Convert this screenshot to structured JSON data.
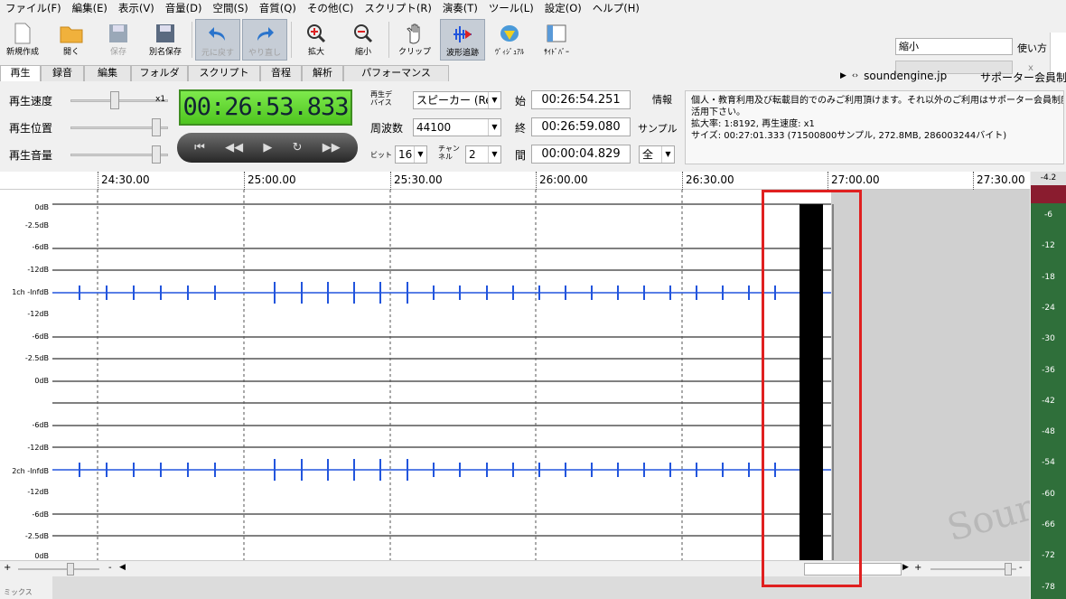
{
  "menu": [
    "ファイル(F)",
    "編集(E)",
    "表示(V)",
    "音量(D)",
    "空間(S)",
    "音質(Q)",
    "その他(C)",
    "スクリプト(R)",
    "演奏(T)",
    "ツール(L)",
    "設定(O)",
    "ヘルプ(H)"
  ],
  "toolbar": {
    "new": "新規作成",
    "open": "開く",
    "save": "保存",
    "save_as": "別名保存",
    "undo": "元に戻す",
    "redo": "やり直し",
    "zoom_in": "拡大",
    "zoom_out": "縮小",
    "clip": "クリップ",
    "wave_follow": "波形追跡",
    "visual": "ｳﾞｨｼﾞｭｱﾙ",
    "sidebar": "ｻｲﾄﾞﾊﾞｰ",
    "zoom_value": "縮小",
    "usage": "使い方",
    "close_mark": "x"
  },
  "tabs": [
    "再生",
    "録音",
    "編集",
    "フォルダ",
    "スクリプト",
    "音程",
    "解析",
    "パフォーマンス"
  ],
  "site": {
    "url": "soundengine.jp",
    "supporter": "サポーター会員制度"
  },
  "playback": {
    "speed_label": "再生速度",
    "position_label": "再生位置",
    "volume_label": "再生音量",
    "speed_mult": "x1",
    "time": "00:26:53.833",
    "device_label": "再生デバイス",
    "device_value": "スピーカー (Realt",
    "freq_label": "周波数",
    "freq_value": "44100",
    "bit_label": "ビット",
    "bit_value": "16",
    "channel_label": "チャンネル",
    "channel_value": "2",
    "start_label": "始",
    "start_value": "00:26:54.251",
    "end_label": "終",
    "end_value": "00:26:59.080",
    "len_label": "間",
    "len_value": "00:00:04.829",
    "info_label": "情報",
    "sample_label": "サンプル",
    "all_value": "全"
  },
  "info": [
    "個人・教育利用及び転載目的でのみご利用頂けます。それ以外のご利用はサポーター会員制度を",
    "活用下さい。",
    "拡大率: 1:8192, 再生速度: x1",
    "サイズ: 00:27:01.333 (71500800サンプル, 272.8MB, 286003244バイト)"
  ],
  "ruler": [
    "24:30.00",
    "25:00.00",
    "25:30.00",
    "26:00.00",
    "26:30.00",
    "27:00.00",
    "27:30.00"
  ],
  "db_labels_ch1": [
    "0dB",
    "-2.5dB",
    "-6dB",
    "-12dB",
    "1ch -InfdB",
    "-12dB",
    "-6dB",
    "-2.5dB",
    "0dB"
  ],
  "db_labels_ch2": [
    "-6dB",
    "-12dB",
    "2ch -InfdB",
    "-12dB",
    "-6dB",
    "-2.5dB",
    "0dB"
  ],
  "meter": {
    "top": "-4.2",
    "ticks": [
      "-6",
      "-12",
      "-18",
      "-24",
      "-30",
      "-36",
      "-42",
      "-48",
      "-54",
      "-60",
      "-66",
      "-72",
      "-78"
    ]
  },
  "watermark": "Soun",
  "mix_label": "ミックス",
  "colors": {
    "wave": "#2255dd",
    "time_bg": "#6ad63a",
    "highlight": "#e02020",
    "meter": "#2f6f3a"
  }
}
